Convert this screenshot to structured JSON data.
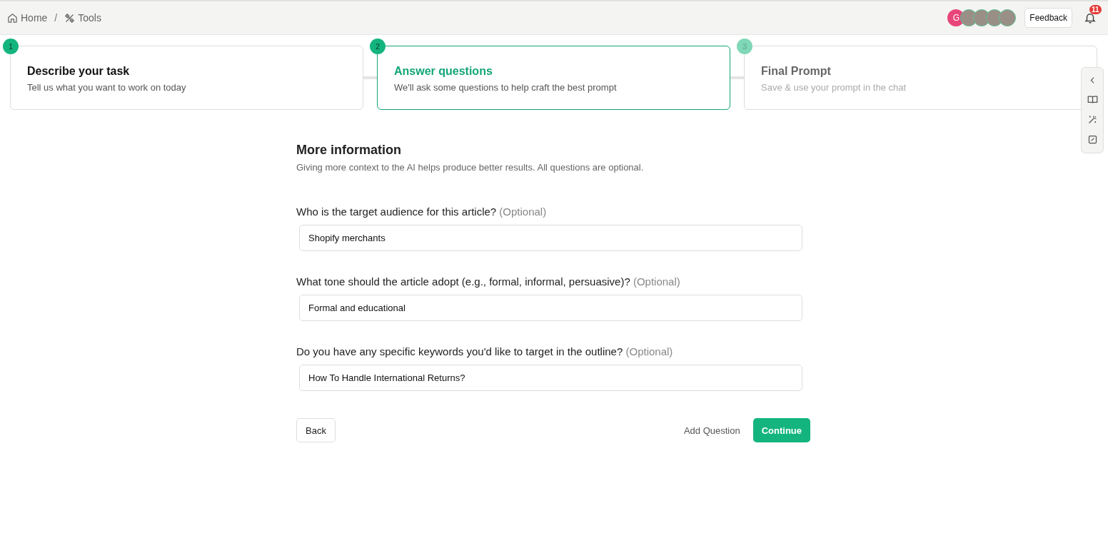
{
  "breadcrumb": [
    {
      "label": "Home",
      "kind": "home"
    },
    {
      "label": "Tools",
      "kind": "tools"
    }
  ],
  "breadcrumb_separator": "/",
  "avatars": [
    {
      "kind": "letter",
      "text": "G"
    },
    {
      "kind": "photo"
    },
    {
      "kind": "photo"
    },
    {
      "kind": "photo"
    },
    {
      "kind": "photo"
    }
  ],
  "feedback_button": "Feedback",
  "notifications": {
    "count": "11"
  },
  "steps": [
    {
      "number": "1",
      "title": "Describe your task",
      "subtitle": "Tell us what you want to work on today",
      "selected": false,
      "disabled": false
    },
    {
      "number": "2",
      "title": "Answer questions",
      "subtitle": "We'll ask some questions to help craft the best prompt",
      "selected": true,
      "disabled": false
    },
    {
      "number": "3",
      "title": "Final Prompt",
      "subtitle": "Save & use your prompt in the chat",
      "selected": false,
      "disabled": true
    }
  ],
  "side_toolbar": [
    {
      "kind": "collapse"
    },
    {
      "kind": "book"
    },
    {
      "kind": "wand"
    },
    {
      "kind": "edit"
    }
  ],
  "form": {
    "title": "More information",
    "description": "Giving more context to the AI helps produce better results. All questions are optional.",
    "questions": [
      {
        "label": "Who is the target audience for this article?",
        "optional_tag": "(Optional)",
        "value": "Shopify merchants"
      },
      {
        "label": "What tone should the article adopt (e.g., formal, informal, persuasive)?",
        "optional_tag": "(Optional)",
        "value": "Formal and educational"
      },
      {
        "label": "Do you have any specific keywords you'd like to target in the outline?",
        "optional_tag": "(Optional)",
        "value": "How To Handle International Returns?"
      }
    ],
    "back_button": "Back",
    "add_question_button": "Add Question",
    "continue_button": "Continue"
  }
}
